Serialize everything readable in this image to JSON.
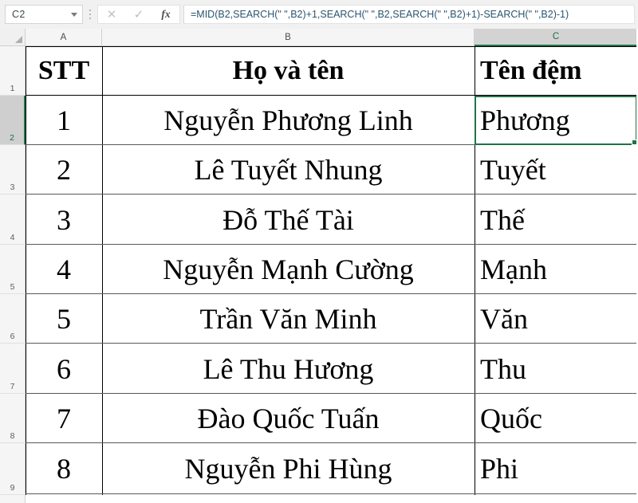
{
  "formula_bar": {
    "name_box_value": "C2",
    "name_box_chevron_icon": "chevron-down-icon",
    "cancel_icon": "close-icon",
    "enter_icon": "check-icon",
    "function_icon": "fx-icon",
    "cancel_label": "✕",
    "enter_label": "✓",
    "function_label": "fx",
    "formula_value": "=MID(B2,SEARCH(\" \",B2)+1,SEARCH(\" \",B2,SEARCH(\" \",B2)+1)-SEARCH(\" \",B2)-1)"
  },
  "sheet": {
    "selected_cell": "C2",
    "selection_color": "#217346",
    "column_headers": [
      "A",
      "B",
      "C"
    ],
    "selected_column": "C",
    "row_headers": [
      "1",
      "2",
      "3",
      "4",
      "5",
      "6",
      "7",
      "8",
      "9"
    ],
    "selected_row": "2",
    "header_row": {
      "a": "STT",
      "b": "Họ và tên",
      "c": "Tên đệm"
    },
    "rows": [
      {
        "a": "1",
        "b": "Nguyễn Phương Linh",
        "c": "Phương"
      },
      {
        "a": "2",
        "b": "Lê Tuyết Nhung",
        "c": "Tuyết"
      },
      {
        "a": "3",
        "b": "Đỗ Thế Tài",
        "c": "Thế"
      },
      {
        "a": "4",
        "b": "Nguyễn Mạnh Cường",
        "c": "Mạnh"
      },
      {
        "a": "5",
        "b": "Trần Văn Minh",
        "c": "Văn"
      },
      {
        "a": "6",
        "b": "Lê Thu Hương",
        "c": "Thu"
      },
      {
        "a": "7",
        "b": "Đào Quốc Tuấn",
        "c": "Quốc"
      },
      {
        "a": "8",
        "b": "Nguyễn Phi Hùng",
        "c": "Phi"
      }
    ]
  }
}
